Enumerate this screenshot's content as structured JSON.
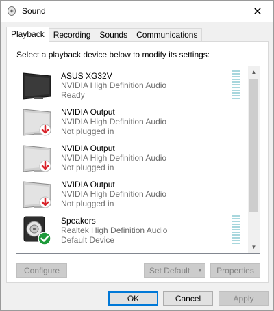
{
  "window": {
    "title": "Sound",
    "close_glyph": "✕"
  },
  "tabs": [
    {
      "label": "Playback",
      "active": true
    },
    {
      "label": "Recording",
      "active": false
    },
    {
      "label": "Sounds",
      "active": false
    },
    {
      "label": "Communications",
      "active": false
    }
  ],
  "playback": {
    "instruction": "Select a playback device below to modify its settings:",
    "devices": [
      {
        "name": "ASUS XG32V",
        "driver": "NVIDIA High Definition Audio",
        "status": "Ready",
        "icon": "monitor-icon",
        "badge": "none",
        "meter": true
      },
      {
        "name": "NVIDIA Output",
        "driver": "NVIDIA High Definition Audio",
        "status": "Not plugged in",
        "icon": "monitor-icon",
        "badge": "unplugged-red-arrow",
        "meter": false
      },
      {
        "name": "NVIDIA Output",
        "driver": "NVIDIA High Definition Audio",
        "status": "Not plugged in",
        "icon": "monitor-icon",
        "badge": "unplugged-red-arrow",
        "meter": false
      },
      {
        "name": "NVIDIA Output",
        "driver": "NVIDIA High Definition Audio",
        "status": "Not plugged in",
        "icon": "monitor-icon",
        "badge": "unplugged-red-arrow",
        "meter": false
      },
      {
        "name": "Speakers",
        "driver": "Realtek High Definition Audio",
        "status": "Default Device",
        "icon": "speaker-icon",
        "badge": "default-green-check",
        "meter": true
      }
    ],
    "buttons": {
      "configure": "Configure",
      "set_default": "Set Default",
      "properties": "Properties"
    }
  },
  "dialog_buttons": {
    "ok": "OK",
    "cancel": "Cancel",
    "apply": "Apply"
  },
  "colors": {
    "accent": "#0078d7",
    "meter": "#a8d7dd",
    "unplugged_badge": "#d9262c",
    "default_badge": "#1e9a3a"
  }
}
